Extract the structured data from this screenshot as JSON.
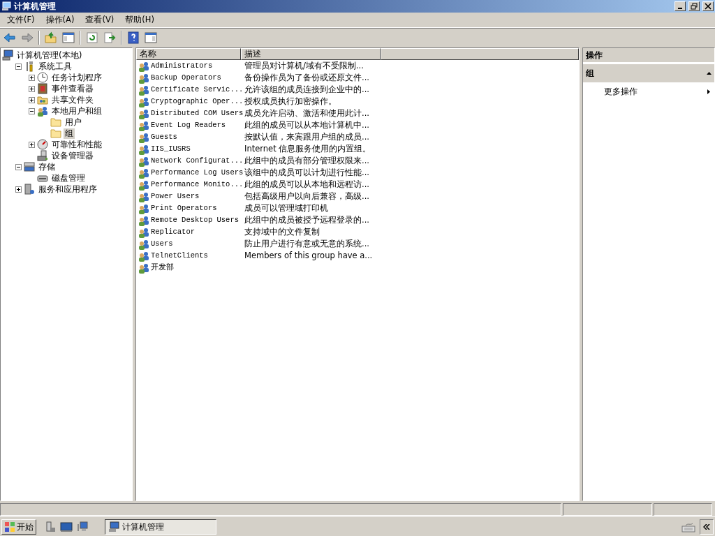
{
  "window": {
    "title": "计算机管理"
  },
  "menu": [
    "文件(F)",
    "操作(A)",
    "查看(V)",
    "帮助(H)"
  ],
  "tree": [
    {
      "label": "计算机管理(本地)",
      "kind": "computer",
      "selected": false,
      "children": [
        {
          "label": "系统工具",
          "kind": "tools",
          "expanded": true,
          "selected": false,
          "children": [
            {
              "label": "任务计划程序",
              "kind": "clock",
              "expanded": false,
              "selected": false
            },
            {
              "label": "事件查看器",
              "kind": "log",
              "expanded": false,
              "selected": false
            },
            {
              "label": "共享文件夹",
              "kind": "share",
              "expanded": false,
              "selected": false
            },
            {
              "label": "本地用户和组",
              "kind": "users",
              "expanded": true,
              "selected": false,
              "children": [
                {
                  "label": "用户",
                  "kind": "folder",
                  "selected": false
                },
                {
                  "label": "组",
                  "kind": "folder",
                  "selected": true
                }
              ]
            },
            {
              "label": "可靠性和性能",
              "kind": "gauge",
              "expanded": false,
              "selected": false
            },
            {
              "label": "设备管理器",
              "kind": "device",
              "selected": false
            }
          ]
        },
        {
          "label": "存储",
          "kind": "storage",
          "expanded": true,
          "selected": false,
          "children": [
            {
              "label": "磁盘管理",
              "kind": "disk",
              "selected": false
            }
          ]
        },
        {
          "label": "服务和应用程序",
          "kind": "services",
          "expanded": false,
          "selected": false
        }
      ]
    }
  ],
  "list": {
    "columns": [
      "名称",
      "描述"
    ],
    "rows": [
      {
        "name": "Administrators",
        "description": "管理员对计算机/域有不受限制..."
      },
      {
        "name": "Backup Operators",
        "description": "备份操作员为了备份或还原文件..."
      },
      {
        "name": "Certificate Servic...",
        "description": "允许该组的成员连接到企业中的..."
      },
      {
        "name": "Cryptographic Oper...",
        "description": "授权成员执行加密操作。"
      },
      {
        "name": "Distributed COM Users",
        "description": "成员允许启动、激活和使用此计..."
      },
      {
        "name": "Event Log Readers",
        "description": "此组的成员可以从本地计算机中..."
      },
      {
        "name": "Guests",
        "description": "按默认值，来宾跟用户组的成员..."
      },
      {
        "name": "IIS_IUSRS",
        "description": "Internet 信息服务使用的内置组。"
      },
      {
        "name": "Network Configurat...",
        "description": "此组中的成员有部分管理权限来..."
      },
      {
        "name": "Performance Log Users",
        "description": "该组中的成员可以计划进行性能..."
      },
      {
        "name": "Performance Monito...",
        "description": "此组的成员可以从本地和远程访..."
      },
      {
        "name": "Power Users",
        "description": "包括高级用户以向后兼容，高级..."
      },
      {
        "name": "Print Operators",
        "description": "成员可以管理域打印机"
      },
      {
        "name": "Remote Desktop Users",
        "description": "此组中的成员被授予远程登录的..."
      },
      {
        "name": "Replicator",
        "description": "支持域中的文件复制"
      },
      {
        "name": "Users",
        "description": "防止用户进行有意或无意的系统..."
      },
      {
        "name": "TelnetClients",
        "description": "Members of this group have a..."
      },
      {
        "name": "开发部"
      }
    ]
  },
  "actions": {
    "header": "操作",
    "section": {
      "title": "组",
      "expanded": true
    },
    "items": [
      "更多操作"
    ]
  },
  "taskbar": {
    "start": "开始",
    "tasks": [
      {
        "label": "计算机管理",
        "selected": true
      }
    ]
  }
}
